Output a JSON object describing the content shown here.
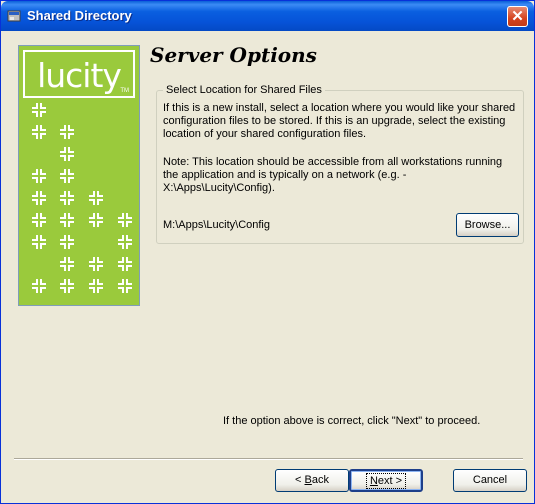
{
  "window": {
    "title": "Shared Directory",
    "close_glyph": "✕",
    "title_icon": "setup-window-icon",
    "colors": {
      "titlebar": "#0A5FD8",
      "close": "#D5431E",
      "face": "#ECE9D8"
    }
  },
  "banner": {
    "logo_text": "lucity",
    "logo_tm": "TM",
    "color": "#9ACA3C",
    "pattern_icon": "plus-cross-icon"
  },
  "page": {
    "heading": "Server Options",
    "group_label": "Select Location for Shared Files",
    "paragraph1": "If this is a new install, select a location where you would like your shared configuration files to be stored. If this is an upgrade, select the existing location of your shared configuration files.",
    "paragraph2": "Note: This location should be accessible from all workstations running the application and is typically on a network (e.g. - X:\\Apps\\Lucity\\Config).",
    "path_value": "M:\\Apps\\Lucity\\Config",
    "browse_label": "Browse...",
    "proceed_text": "If the option above is correct, click \"Next\" to proceed."
  },
  "buttons": {
    "back_prefix": "< ",
    "back_mnemonic": "B",
    "back_rest": "ack",
    "next_mnemonic": "N",
    "next_rest": "ext >",
    "cancel": "Cancel"
  }
}
